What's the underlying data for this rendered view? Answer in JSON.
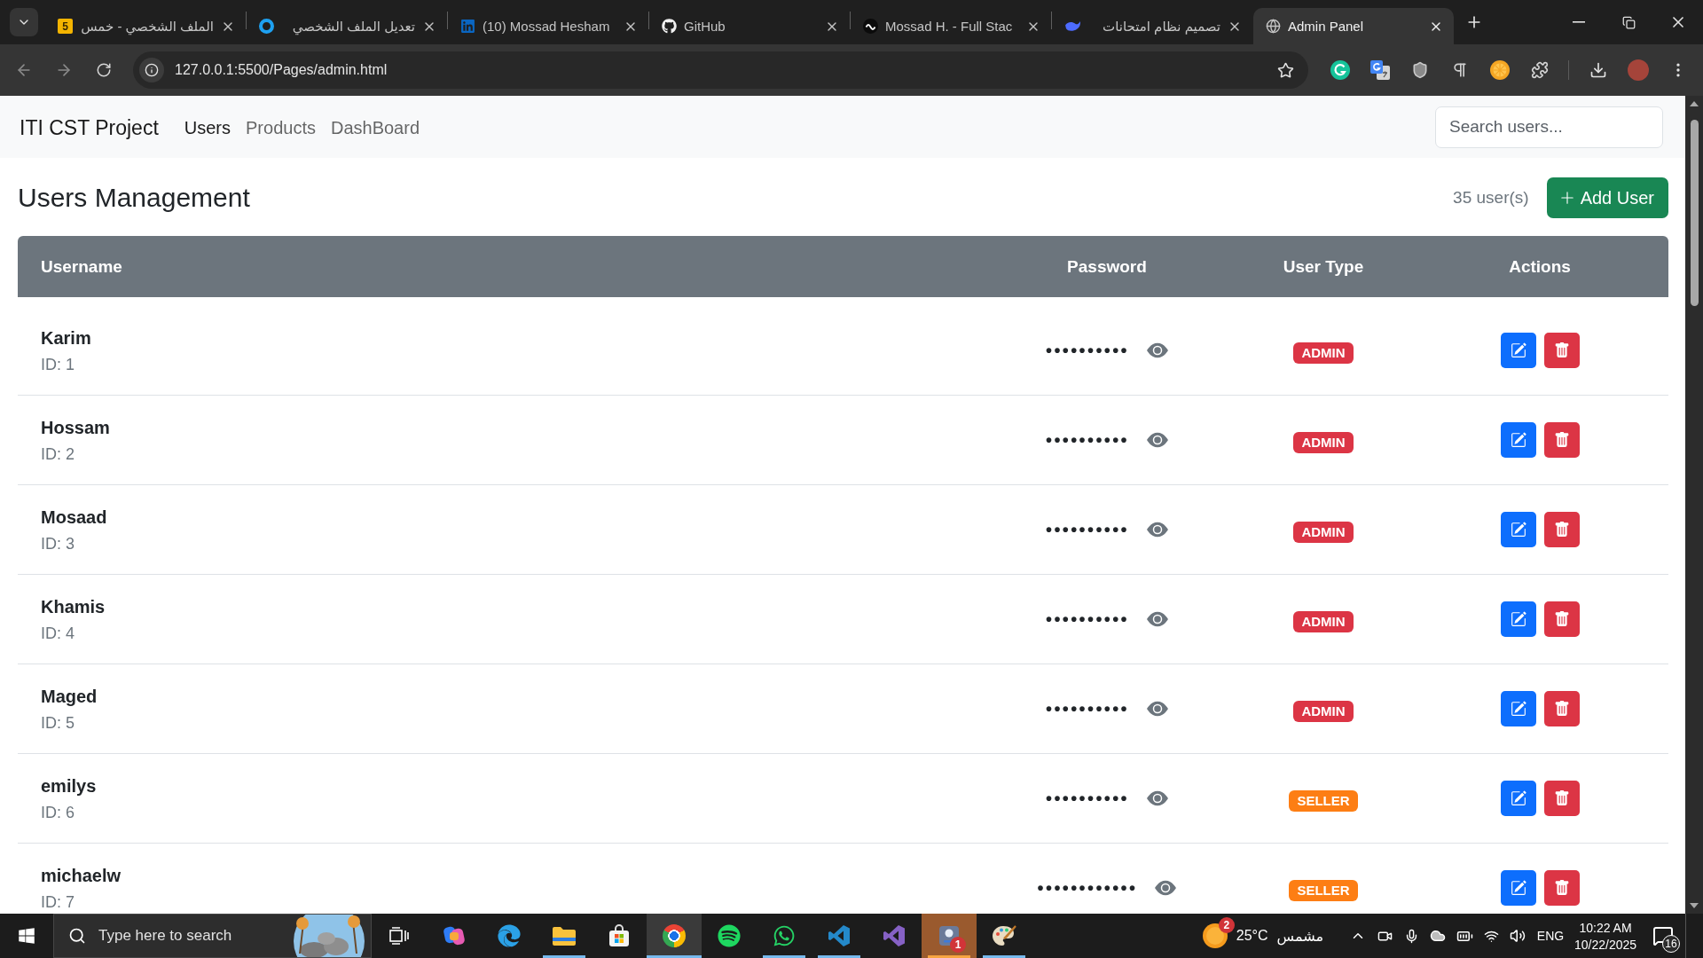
{
  "browser": {
    "tabs": [
      {
        "title": "الملف الشخصي - خمس",
        "kind": "tile",
        "tile_text": "5",
        "selected": false
      },
      {
        "title": "تعديل الملف الشخصي",
        "kind": "ring",
        "selected": false
      },
      {
        "title": "(10) Mossad Hesham",
        "kind": "linkedin",
        "selected": false
      },
      {
        "title": "GitHub",
        "kind": "github",
        "selected": false
      },
      {
        "title": "Mossad H. - Full Stac",
        "kind": "upwork",
        "selected": false
      },
      {
        "title": "تصميم نظام امتحانات",
        "kind": "whale",
        "selected": false
      },
      {
        "title": "Admin Panel",
        "kind": "globe",
        "selected": true
      }
    ],
    "nav_buttons": [
      {
        "kind": "back",
        "disabled": true
      },
      {
        "kind": "forward",
        "disabled": true
      },
      {
        "kind": "reload",
        "disabled": false
      }
    ],
    "url": "127.0.0.1:5500/Pages/admin.html"
  },
  "navbar": {
    "brand": "ITI CST Project",
    "links": [
      {
        "label": "Users",
        "selected": true
      },
      {
        "label": "Products",
        "selected": false
      },
      {
        "label": "DashBoard",
        "selected": false
      }
    ],
    "search": {
      "placeholder": "Search users..."
    }
  },
  "header": {
    "title": "Users Management",
    "count": "35 user(s)",
    "add_button": "Add User"
  },
  "table": {
    "columns": [
      "Username",
      "Password",
      "User Type",
      "Actions"
    ],
    "rows": [
      {
        "username": "Karim",
        "id": "ID: 1",
        "password": "••••••••••",
        "role": "ADMIN",
        "color": "#dc3545"
      },
      {
        "username": "Hossam",
        "id": "ID: 2",
        "password": "••••••••••",
        "role": "ADMIN",
        "color": "#dc3545"
      },
      {
        "username": "Mosaad",
        "id": "ID: 3",
        "password": "••••••••••",
        "role": "ADMIN",
        "color": "#dc3545"
      },
      {
        "username": "Khamis",
        "id": "ID: 4",
        "password": "••••••••••",
        "role": "ADMIN",
        "color": "#dc3545"
      },
      {
        "username": "Maged",
        "id": "ID: 5",
        "password": "••••••••••",
        "role": "ADMIN",
        "color": "#dc3545"
      },
      {
        "username": "emilys",
        "id": "ID: 6",
        "password": "••••••••••",
        "role": "SELLER",
        "color": "#fd7e14"
      },
      {
        "username": "michaelw",
        "id": "ID: 7",
        "password": "••••••••••••",
        "role": "SELLER",
        "color": "#fd7e14"
      }
    ]
  },
  "taskbar": {
    "search": {
      "placeholder": "Type here to search"
    },
    "apps": [
      {
        "kind": "copilot",
        "running": false,
        "selected": false,
        "attention": false
      },
      {
        "kind": "edge",
        "running": false,
        "selected": false,
        "attention": false
      },
      {
        "kind": "files",
        "running": true,
        "selected": false,
        "attention": false
      },
      {
        "kind": "store",
        "running": false,
        "selected": false,
        "attention": false
      },
      {
        "kind": "chrome",
        "running": true,
        "selected": true,
        "attention": false
      },
      {
        "kind": "spotify",
        "running": false,
        "selected": false,
        "attention": false
      },
      {
        "kind": "whatsapp",
        "running": true,
        "selected": false,
        "attention": false
      },
      {
        "kind": "vscode",
        "running": true,
        "selected": false,
        "attention": false
      },
      {
        "kind": "visual-studio",
        "running": false,
        "selected": false,
        "attention": false
      },
      {
        "kind": "pin",
        "running": true,
        "selected": false,
        "attention": true,
        "badge": "1"
      },
      {
        "kind": "paint",
        "running": true,
        "selected": false,
        "attention": false
      }
    ],
    "weather": {
      "temperature": "25°C",
      "condition": "مشمس",
      "badge": "2"
    },
    "language": "ENG",
    "time": "10:22 AM",
    "date": "10/22/2025",
    "notifications": "16"
  }
}
